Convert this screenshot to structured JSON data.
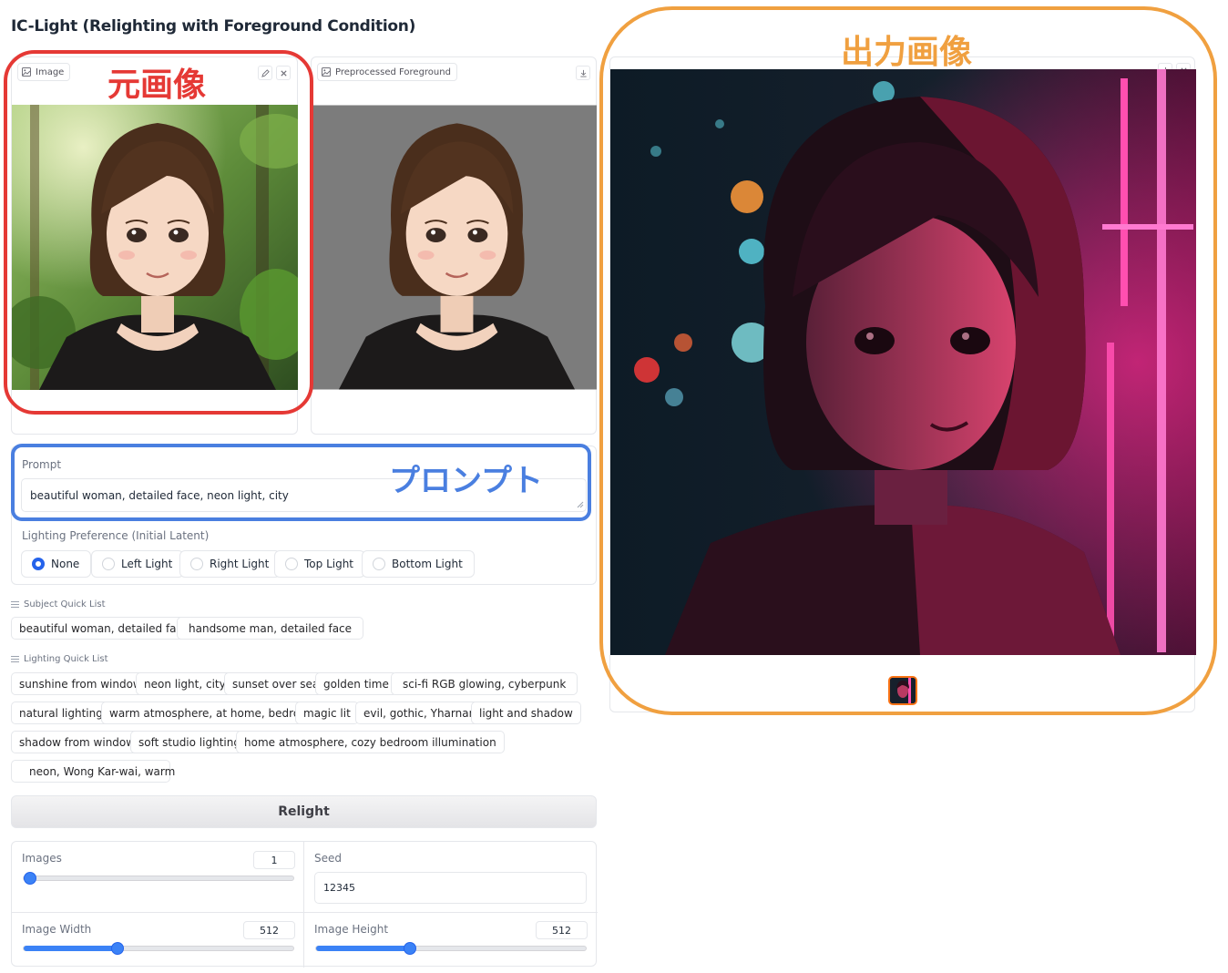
{
  "app": {
    "title": "IC-Light (Relighting with Foreground Condition)"
  },
  "input_panel": {
    "label": "Image",
    "icon": "image-icon",
    "edit_icon": "pencil-icon",
    "close_icon": "close-icon"
  },
  "preprocessed_panel": {
    "label": "Preprocessed Foreground",
    "icon": "image-icon",
    "download_icon": "download-icon"
  },
  "output_panel": {
    "download_icon": "download-icon",
    "close_icon": "close-icon",
    "thumbnail_icon": "thumbnail-icon"
  },
  "prompt": {
    "label": "Prompt",
    "value": "beautiful woman, detailed face, neon light, city"
  },
  "lighting": {
    "label": "Lighting Preference (Initial Latent)",
    "options": [
      "None",
      "Left Light",
      "Right Light",
      "Top Light",
      "Bottom Light"
    ],
    "selected": "None"
  },
  "subject_quick_list": {
    "label": "Subject Quick List",
    "icon": "list-icon",
    "items": [
      "beautiful woman, detailed face",
      "handsome man, detailed face"
    ]
  },
  "lighting_quick_list": {
    "label": "Lighting Quick List",
    "icon": "list-icon",
    "items": [
      "sunshine from window",
      "neon light, city",
      "sunset over sea",
      "golden time",
      "sci-fi RGB glowing, cyberpunk",
      "natural lighting",
      "warm atmosphere, at home, bedroom",
      "magic lit",
      "evil, gothic, Yharnam",
      "light and shadow",
      "shadow from window",
      "soft studio lighting",
      "home atmosphere, cozy bedroom illumination",
      "neon, Wong Kar-wai, warm"
    ]
  },
  "relight_button": "Relight",
  "settings": {
    "images": {
      "label": "Images",
      "value": "1",
      "fraction": 0.0
    },
    "seed": {
      "label": "Seed",
      "value": "12345"
    },
    "width": {
      "label": "Image Width",
      "value": "512",
      "fraction": 0.34
    },
    "height": {
      "label": "Image Height",
      "value": "512",
      "fraction": 0.34
    }
  },
  "annotations": {
    "original": "元画像",
    "prompt": "プロンプト",
    "output": "出力画像",
    "colors": {
      "original": "#e53935",
      "prompt": "#4a7fe0",
      "output": "#f0a040"
    }
  }
}
